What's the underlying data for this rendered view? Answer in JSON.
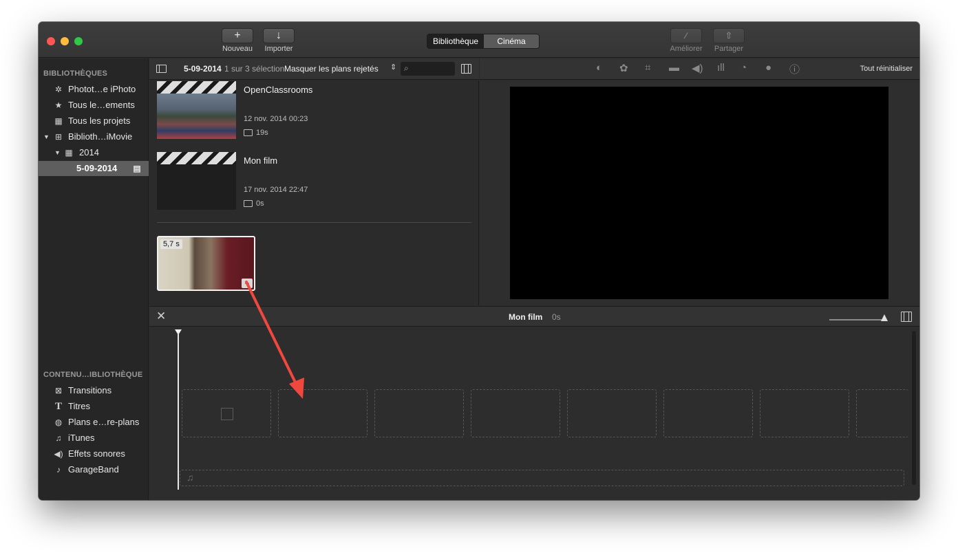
{
  "toolbar": {
    "new_label": "Nouveau",
    "import_label": "Importer",
    "enhance_label": "Améliorer",
    "share_label": "Partager",
    "seg_library": "Bibliothèque",
    "seg_theater": "Cinéma"
  },
  "sidebar": {
    "libraries_header": "BIBLIOTHÈQUES",
    "items": [
      {
        "label": "Photot…e iPhoto",
        "icon": "palm-tree-icon"
      },
      {
        "label": "Tous le…ements",
        "icon": "star-icon"
      },
      {
        "label": "Tous les projets",
        "icon": "clapper-icon"
      },
      {
        "label": "Biblioth…iMovie",
        "icon": "grid-icon"
      },
      {
        "label": "2014",
        "icon": "calendar-icon"
      },
      {
        "label": "5-09-2014",
        "icon": "clapper-icon"
      }
    ],
    "content_header": "CONTENU…IBLIOTHÈQUE",
    "content_items": [
      {
        "label": "Transitions",
        "icon": "transitions-icon"
      },
      {
        "label": "Titres",
        "icon": "titles-icon"
      },
      {
        "label": "Plans e…re-plans",
        "icon": "globe-icon"
      },
      {
        "label": "iTunes",
        "icon": "music-note-icon"
      },
      {
        "label": "Effets sonores",
        "icon": "speaker-icon"
      },
      {
        "label": "GarageBand",
        "icon": "guitar-icon"
      }
    ]
  },
  "browser": {
    "event_name": "5-09-2014",
    "selection_info": "1 sur 3 sélection",
    "filter_label": "Masquer les plans rejetés",
    "projects": [
      {
        "title": "OpenClassrooms",
        "date": "12 nov. 2014 00:23",
        "duration": "19s"
      },
      {
        "title": "Mon film",
        "date": "17 nov. 2014 22:47",
        "duration": "0s"
      }
    ],
    "clip": {
      "duration": "5,7 s"
    }
  },
  "viewer": {
    "reset_label": "Tout réinitialiser"
  },
  "timeline": {
    "project_name": "Mon film",
    "project_duration": "0s"
  },
  "colors": {
    "accent_arrow": "#f0483e",
    "selection": "#5e5e5e"
  }
}
